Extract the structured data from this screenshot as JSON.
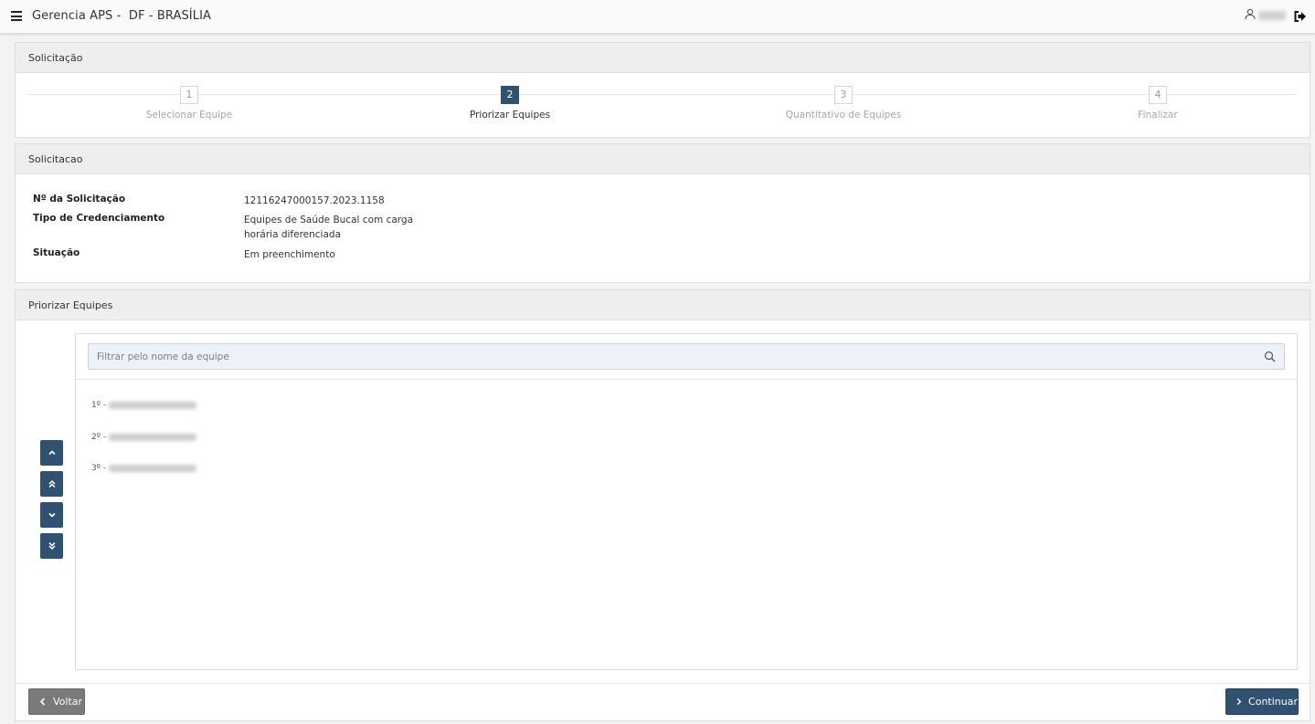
{
  "header": {
    "title": "Gerencia APS -  DF - BRASÍLIA"
  },
  "stepper_panel": {
    "title": "Solicitação",
    "steps": [
      {
        "number": "1",
        "label": "Selecionar Equipe"
      },
      {
        "number": "2",
        "label": "Priorizar Equipes"
      },
      {
        "number": "3",
        "label": "Quantitativo de Equipes"
      },
      {
        "number": "4",
        "label": "Finalizar"
      }
    ],
    "active_step": "2"
  },
  "info_panel": {
    "title": "Solicitacao",
    "rows": [
      {
        "label": "Nº da Solicitação",
        "value": "12116247000157.2023.1158"
      },
      {
        "label": "Tipo de Credenciamento",
        "value": "Equipes de Saúde Bucal com carga horária diferenciada"
      },
      {
        "label": "Situação",
        "value": "Em preenchimento"
      }
    ]
  },
  "priority_panel": {
    "title": "Priorizar Equipes",
    "filter_placeholder": "Filtrar pelo nome da equipe",
    "items": [
      {
        "position": "1º -"
      },
      {
        "position": "2º -"
      },
      {
        "position": "3º -"
      }
    ],
    "controls": [
      "chevron-up-icon",
      "double-chevron-up-icon",
      "chevron-down-icon",
      "double-chevron-down-icon"
    ]
  },
  "footer": {
    "back_label": "Voltar",
    "continue_label": "Continuar"
  },
  "colors": {
    "primary": "#2f5272",
    "secondary": "#7a7a7a",
    "panel_header": "#eeeeee"
  }
}
